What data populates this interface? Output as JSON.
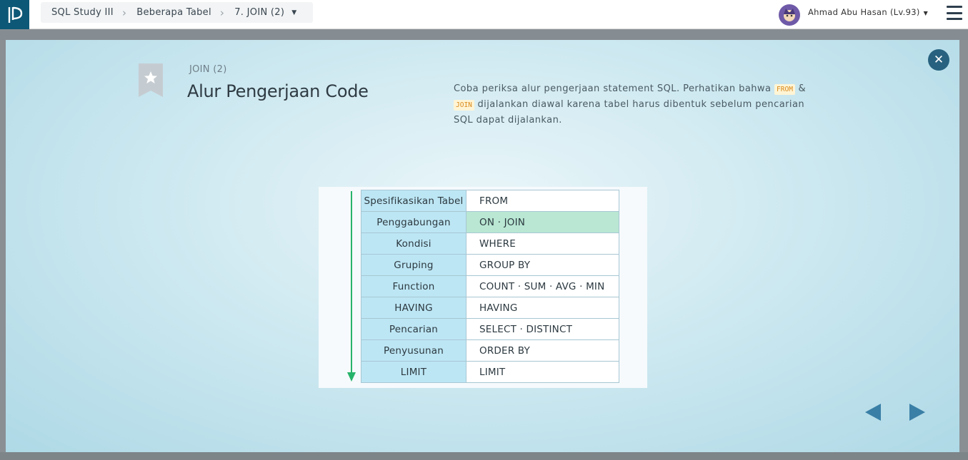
{
  "header": {
    "breadcrumb": {
      "course": "SQL Study III",
      "section": "Beberapa Tabel",
      "lesson": "7. JOIN (2)"
    },
    "user": {
      "name": "Ahmad Abu Hasan (Lv.93)"
    },
    "icons": {
      "logo": "progate-logo",
      "menu": "hamburger-icon",
      "caret": "caret-down-icon"
    }
  },
  "modal": {
    "subtitle": "JOIN (2)",
    "title": "Alur Pengerjaan Code",
    "description": {
      "part1": "Coba periksa alur pengerjaan statement SQL. Perhatikan bahwa ",
      "code1": "FROM",
      "part2": " & ",
      "code2": "JOIN",
      "part3": " dijalankan diawal karena tabel harus dibentuk sebelum pencarian SQL dapat dijalankan."
    },
    "flow": [
      {
        "label": "Spesifikasikan Tabel",
        "keyword": "FROM",
        "highlight": false
      },
      {
        "label": "Penggabungan",
        "keyword": "ON · JOIN",
        "highlight": true
      },
      {
        "label": "Kondisi",
        "keyword": "WHERE",
        "highlight": false
      },
      {
        "label": "Gruping",
        "keyword": "GROUP BY",
        "highlight": false
      },
      {
        "label": "Function",
        "keyword": "COUNT · SUM · AVG · MIN",
        "highlight": false
      },
      {
        "label": "HAVING",
        "keyword": "HAVING",
        "highlight": false
      },
      {
        "label": "Pencarian",
        "keyword": "SELECT · DISTINCT",
        "highlight": false
      },
      {
        "label": "Penyusunan",
        "keyword": "ORDER BY",
        "highlight": false
      },
      {
        "label": "LIMIT",
        "keyword": "LIMIT",
        "highlight": false
      }
    ],
    "colors": {
      "accent": "#27617f",
      "flow_arrow": "#27b36a",
      "highlight": "#b9e7d3",
      "label_cell": "#bde6f4"
    }
  }
}
